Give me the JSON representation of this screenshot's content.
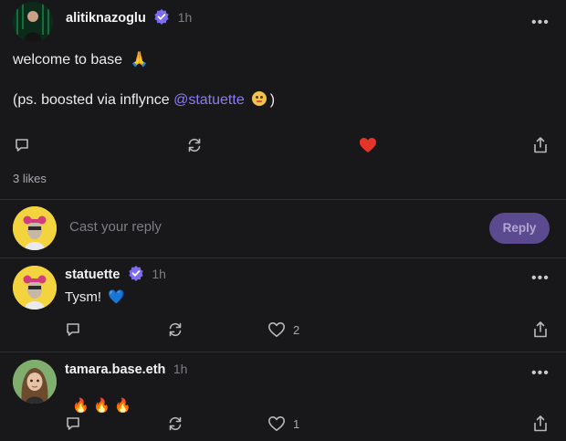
{
  "post": {
    "author": "alitiknazoglu",
    "time": "1h",
    "line1": "welcome to base",
    "line1_emoji": "🙏",
    "line2_prefix": "(ps. boosted via inflynce ",
    "line2_mention": "@statuette",
    "line2_suffix": ")",
    "likes_text": "3 likes"
  },
  "composer": {
    "placeholder": "Cast your reply",
    "button_label": "Reply"
  },
  "replies": [
    {
      "author": "statuette",
      "time": "1h",
      "text": "Tysm!",
      "emoji": "💙",
      "likes": "2"
    },
    {
      "author": "tamara.base.eth",
      "time": "1h",
      "text": "🔥 🔥 🔥",
      "likes": "1"
    }
  ],
  "colors": {
    "background": "#18181b",
    "accent": "#8b7cf6",
    "heart_liked": "#e5352a",
    "verified": "#7c6cf0"
  },
  "icons": {
    "more": "more-horizontal-icon",
    "comment": "comment-icon",
    "recast": "recast-icon",
    "like": "heart-icon",
    "share": "share-icon",
    "verified": "verified-badge-icon"
  }
}
